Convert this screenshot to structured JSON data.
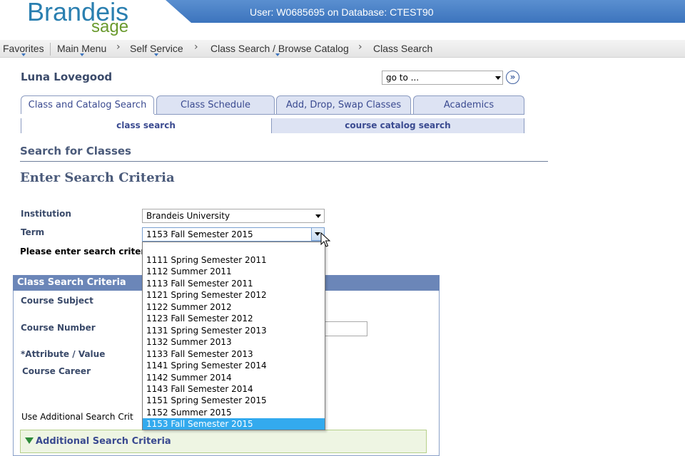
{
  "header": {
    "logo_main": "Brandeis",
    "logo_sub": "sage",
    "user_info": "User: W0685695 on Database: CTEST90"
  },
  "nav": {
    "favorites": "Favorites",
    "main_menu": "Main Menu",
    "self_service": "Self Service",
    "class_search_browse": "Class Search / Browse Catalog",
    "class_search": "Class Search",
    "separator": "›"
  },
  "user": {
    "name": "Luna Lovegood",
    "goto_value": "go to ...",
    "goto_button": "»"
  },
  "tabs": [
    {
      "label": "Class and Catalog Search",
      "active": true
    },
    {
      "label": "Class Schedule",
      "active": false
    },
    {
      "label": "Add, Drop, Swap Classes",
      "active": false
    },
    {
      "label": "Academics",
      "active": false
    }
  ],
  "subtabs": [
    {
      "label": "class search",
      "active": true
    },
    {
      "label": "course catalog search",
      "active": false
    }
  ],
  "page": {
    "title": "Search for Classes",
    "subtitle": "Enter Search Criteria",
    "instructions": "Please enter search criter"
  },
  "form": {
    "institution_label": "Institution",
    "institution_value": "Brandeis University",
    "term_label": "Term",
    "term_value": "1153 Fall Semester 2015",
    "criteria_header": "Class Search Criteria",
    "course_subject_label": "Course Subject",
    "course_number_label": "Course Number",
    "attribute_label": "*Attribute / Value",
    "course_career_label": "Course Career",
    "use_additional_label": "Use Additional Search Crit",
    "additional_criteria": "Additional Search Criteria"
  },
  "term_options": [
    "1111 Spring Semester 2011",
    "1112 Summer 2011",
    "1113 Fall Semester 2011",
    "1121 Spring Semester 2012",
    "1122 Summer 2012",
    "1123 Fall Semester 2012",
    "1131 Spring Semester 2013",
    "1132 Summer 2013",
    "1133 Fall Semester 2013",
    "1141 Spring Semester 2014",
    "1142 Summer 2014",
    "1143 Fall Semester 2014",
    "1151 Spring Semester 2015",
    "1152 Summer 2015",
    "1153 Fall Semester 2015"
  ],
  "term_selected_index": 14,
  "colors": {
    "topbar": "#3c74bd",
    "logo_blue": "#2a7fb0",
    "logo_green": "#6a9a2e",
    "selection": "#33aaee"
  }
}
